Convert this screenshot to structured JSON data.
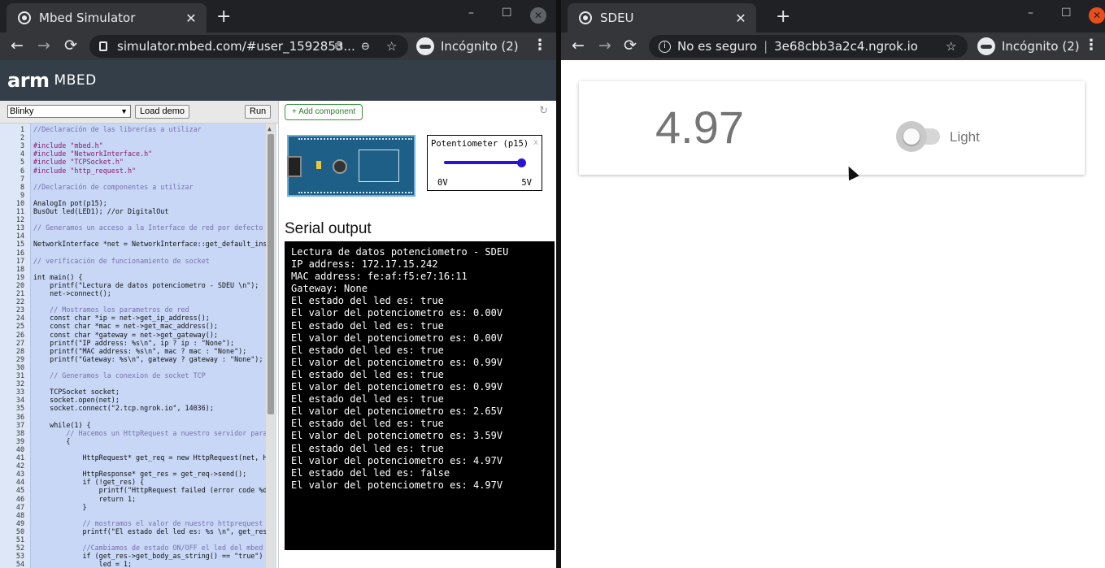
{
  "left_window": {
    "tab_title": "Mbed Simulator",
    "tab_close": "✕",
    "new_tab": "+",
    "window_controls": [
      "–",
      "☐",
      "✕"
    ],
    "url": "simulator.mbed.com/#user_1592853...",
    "incognito": "Incógnito (2)",
    "logo_arm": "arm",
    "logo_mbed": "MBED",
    "demo_select": "Blinky",
    "load_demo": "Load demo",
    "run": "Run",
    "add_component": "+ Add component",
    "potentiometer": {
      "title": "Potentiometer (p15)",
      "min_label": "0V",
      "max_label": "5V",
      "level": 0.97
    },
    "serial_title": "Serial output",
    "serial_lines": [
      "Lectura de datos potenciometro - SDEU",
      "IP address: 172.17.15.242",
      "MAC address: fe:af:f5:e7:16:11",
      "Gateway: None",
      "El estado del led es: true",
      "El valor del potenciometro es: 0.00V",
      "El estado del led es: true",
      "El valor del potenciometro es: 0.00V",
      "El estado del led es: true",
      "El valor del potenciometro es: 0.99V",
      "El estado del led es: true",
      "El valor del potenciometro es: 0.99V",
      "El estado del led es: true",
      "El valor del potenciometro es: 2.65V",
      "El estado del led es: true",
      "El valor del potenciometro es: 3.59V",
      "El estado del led es: true",
      "El valor del potenciometro es: 4.97V",
      "El estado del led es: false",
      "El valor del potenciometro es: 4.97V"
    ],
    "code_lines": [
      "//Declaración de las librerías a utilizar",
      "",
      "#include \"mbed.h\"",
      "#include \"NetworkInterface.h\"",
      "#include \"TCPSocket.h\"",
      "#include \"http_request.h\"",
      "",
      "//Declaración de componentes a utilizar",
      "",
      "AnalogIn pot(p15);",
      "BusOut led(LED1); //or DigitalOut",
      "",
      "// Generamos un acceso a la Interface de red por defecto",
      "",
      "NetworkInterface *net = NetworkInterface::get_default_insta",
      "",
      "// verificación de funcionamiento de socket",
      "",
      "int main() {",
      "    printf(\"Lectura de datos potenciometro - SDEU \\n\");",
      "    net->connect();",
      "",
      "    // Mostramos los parametros de red",
      "    const char *ip = net->get_ip_address();",
      "    const char *mac = net->get_mac_address();",
      "    const char *gateway = net->get_gateway();",
      "    printf(\"IP address: %s\\n\", ip ? ip : \"None\");",
      "    printf(\"MAC address: %s\\n\", mac ? mac : \"None\");",
      "    printf(\"Gateway: %s\\n\", gateway ? gateway : \"None\");",
      "",
      "    // Generamos la conexion de socket TCP",
      "",
      "    TCPSocket socket;",
      "    socket.open(net);",
      "    socket.connect(\"2.tcp.ngrok.io\", 14036);",
      "",
      "    while(1) {",
      "        // Hacemos un HttpRequest a nuestro servidor para o",
      "        {",
      "",
      "            HttpRequest* get_req = new HttpRequest(net, HTT",
      "",
      "            HttpResponse* get_res = get_req->send();",
      "            if (!get_res) {",
      "                printf(\"HttpRequest failed (error code %d)\\",
      "                return 1;",
      "            }",
      "",
      "            // mostramos el valor de nuestro httprequest",
      "            printf(\"El estado del led es: %s \\n\", get_res->",
      "",
      "            //Cambiamos de estado ON/OFF el led del mbed",
      "            if (get_res->get_body_as_string() == \"true\") {",
      "                led = 1;"
    ]
  },
  "right_window": {
    "tab_title": "SDEU",
    "tab_close": "✕",
    "new_tab": "+",
    "window_controls": [
      "–",
      "☐",
      "✕"
    ],
    "security": "No es seguro",
    "url": "3e68cbb3a2c4.ngrok.io",
    "incognito": "Incógnito (2)",
    "value": "4.97",
    "toggle_label": "Light",
    "toggle_on": false
  },
  "colors": {
    "chrome_dark": "#202124",
    "chrome_toolbar": "#35363a",
    "mbed_header": "#333e48",
    "editor_selection": "#c7d7f5",
    "pot_blue": "#2a14d4",
    "serial_bg": "#000000"
  },
  "icons": {
    "back": "←",
    "forward": "→",
    "reload": "⟳",
    "star": "☆",
    "zoom": "🔍",
    "menu": "⋮",
    "refresh_small": "↻"
  }
}
